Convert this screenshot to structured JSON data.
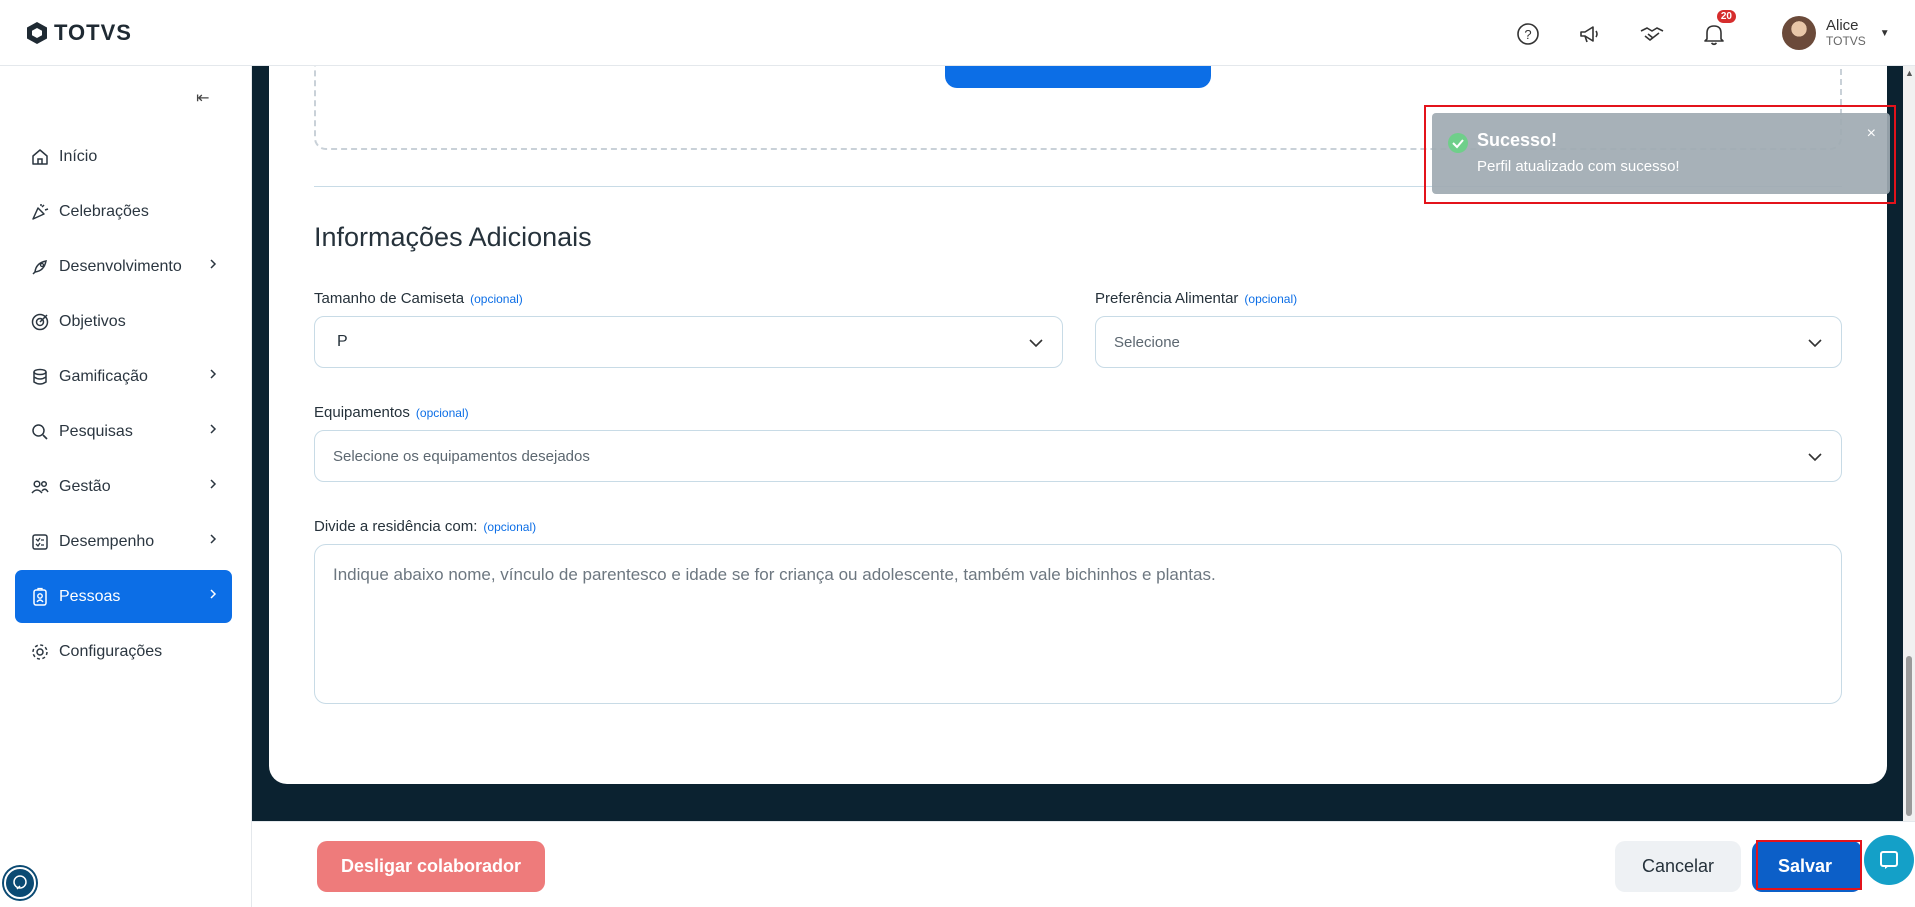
{
  "brand": {
    "logo_text": "TOTVS"
  },
  "header": {
    "notification_count": "20",
    "user": {
      "name": "Alice",
      "org": "TOTVS"
    }
  },
  "sidebar": {
    "items": [
      {
        "label": "Início",
        "icon": "home-icon",
        "has_submenu": false,
        "active": false
      },
      {
        "label": "Celebrações",
        "icon": "party-popper-icon",
        "has_submenu": false,
        "active": false
      },
      {
        "label": "Desenvolvimento",
        "icon": "rocket-icon",
        "has_submenu": true,
        "active": false
      },
      {
        "label": "Objetivos",
        "icon": "target-icon",
        "has_submenu": false,
        "active": false
      },
      {
        "label": "Gamificação",
        "icon": "coins-icon",
        "has_submenu": true,
        "active": false
      },
      {
        "label": "Pesquisas",
        "icon": "survey-search-icon",
        "has_submenu": true,
        "active": false
      },
      {
        "label": "Gestão",
        "icon": "people-icon",
        "has_submenu": true,
        "active": false
      },
      {
        "label": "Desempenho",
        "icon": "checklist-icon",
        "has_submenu": true,
        "active": false
      },
      {
        "label": "Pessoas",
        "icon": "badge-icon",
        "has_submenu": true,
        "active": true
      },
      {
        "label": "Configurações",
        "icon": "gear-icon",
        "has_submenu": false,
        "active": false
      }
    ]
  },
  "form": {
    "section_title": "Informações Adicionais",
    "optional_tag": "(opcional)",
    "shirt_size": {
      "label": "Tamanho de Camiseta",
      "value": "P"
    },
    "food_pref": {
      "label": "Preferência Alimentar",
      "placeholder": "Selecione"
    },
    "equipment": {
      "label": "Equipamentos",
      "placeholder": "Selecione os equipamentos desejados"
    },
    "household": {
      "label": "Divide a residência com:",
      "placeholder": "Indique abaixo nome, vínculo de parentesco e idade se for criança ou adolescente, também vale bichinhos e plantas."
    }
  },
  "footer": {
    "dismiss_label": "Desligar colaborador",
    "cancel_label": "Cancelar",
    "save_label": "Salvar"
  },
  "toast": {
    "title": "Sucesso!",
    "message": "Perfil atualizado com sucesso!",
    "close": "×"
  },
  "colors": {
    "primary": "#0c6ee6",
    "danger": "#ee7b7b",
    "content_bg": "#0b2230",
    "highlight": "#e3131b"
  }
}
